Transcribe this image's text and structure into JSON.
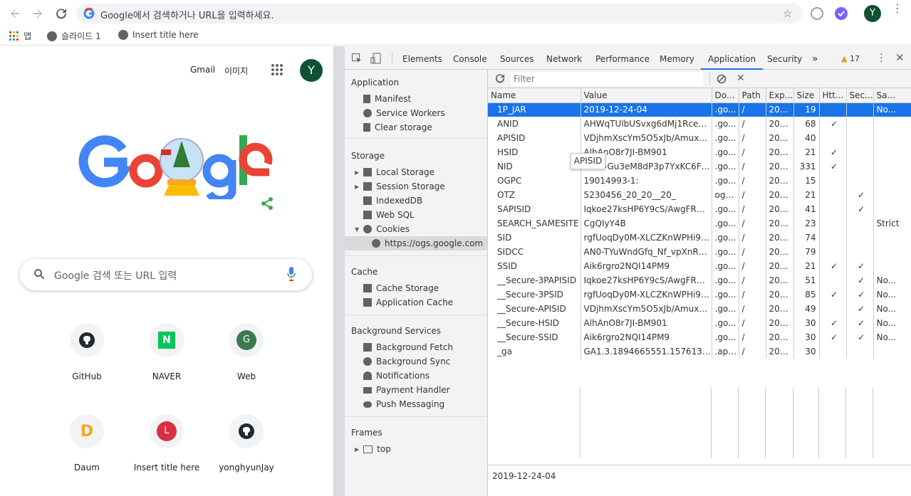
{
  "browser": {
    "omnibox_placeholder": "Google에서 검색하거나 URL을 입력하세요.",
    "avatar_letter": "Y",
    "bookmarks": [
      {
        "label": "앱"
      },
      {
        "label": "슬라이드 1"
      },
      {
        "label": "Insert title here"
      }
    ]
  },
  "ntp": {
    "top_links": [
      "Gmail",
      "이미지"
    ],
    "avatar_letter": "Y",
    "search_placeholder": "Google 검색 또는 URL 입력",
    "shortcuts": [
      {
        "label": "GitHub",
        "glyph": "",
        "color": "#24292e"
      },
      {
        "label": "NAVER",
        "glyph": "N",
        "color": "#03c75a"
      },
      {
        "label": "Web",
        "glyph": "G",
        "color": "#3c7a4f"
      },
      {
        "label": "Daum",
        "glyph": "D",
        "color": "#f1f3f4"
      },
      {
        "label": "Insert title here",
        "glyph": "L",
        "color": "#d93040"
      },
      {
        "label": "yonghyunJay",
        "glyph": "",
        "color": "#24292e"
      }
    ]
  },
  "devtools": {
    "tabs": [
      "Elements",
      "Console",
      "Sources",
      "Network",
      "Performance",
      "Memory",
      "Application",
      "Security"
    ],
    "active_tab": "Application",
    "more_tabs": "»",
    "warnings": "17",
    "sidebar": {
      "application": {
        "title": "Application",
        "items": [
          "Manifest",
          "Service Workers",
          "Clear storage"
        ]
      },
      "storage": {
        "title": "Storage",
        "items": [
          "Local Storage",
          "Session Storage",
          "IndexedDB",
          "Web SQL",
          "Cookies",
          "https://ogs.google.com"
        ]
      },
      "cache": {
        "title": "Cache",
        "items": [
          "Cache Storage",
          "Application Cache"
        ]
      },
      "background": {
        "title": "Background Services",
        "items": [
          "Background Fetch",
          "Background Sync",
          "Notifications",
          "Payment Handler",
          "Push Messaging"
        ]
      },
      "frames": {
        "title": "Frames",
        "items": [
          "top"
        ]
      }
    },
    "filter_placeholder": "Filter",
    "columns": [
      "Name",
      "Value",
      "Do...",
      "Path",
      "Exp...",
      "Size",
      "Htt...",
      "Sec...",
      "Sa..."
    ],
    "cookies": [
      {
        "name": "1P_JAR",
        "value": "2019-12-24-04",
        "domain": ".go...",
        "path": "/",
        "expires": "202...",
        "size": "19",
        "http": "",
        "secure": "",
        "same": "No...",
        "selected": true
      },
      {
        "name": "ANID",
        "value": "AHWqTUlbUSvxg6dMj1RceKbA...",
        "domain": ".go...",
        "path": "/",
        "expires": "202...",
        "size": "68",
        "http": "✓",
        "secure": "",
        "same": ""
      },
      {
        "name": "APISID",
        "value": "VDjhmXscYm5O5xJb/Amux9Xa...",
        "domain": ".go...",
        "path": "/",
        "expires": "202...",
        "size": "40",
        "http": "",
        "secure": "",
        "same": ""
      },
      {
        "name": "HSID",
        "value": "AlhAnO8r7JI-BM901",
        "domain": ".go...",
        "path": "/",
        "expires": "202...",
        "size": "21",
        "http": "✓",
        "secure": "",
        "same": ""
      },
      {
        "name": "NID",
        "value": "194=Gu3eM8dP3p7YxKC6F-ldf...",
        "domain": ".go...",
        "path": "/",
        "expires": "202...",
        "size": "331",
        "http": "✓",
        "secure": "",
        "same": ""
      },
      {
        "name": "OGPC",
        "value": "19014993-1:",
        "domain": ".go...",
        "path": "/",
        "expires": "202...",
        "size": "15",
        "http": "",
        "secure": "",
        "same": ""
      },
      {
        "name": "OTZ",
        "value": "5230456_20_20__20_",
        "domain": "ogs....",
        "path": "/",
        "expires": "202...",
        "size": "21",
        "http": "",
        "secure": "✓",
        "same": ""
      },
      {
        "name": "SAPISID",
        "value": "Iqkoe27ksHP6Y9cS/AwgFRD6C...",
        "domain": ".go...",
        "path": "/",
        "expires": "202...",
        "size": "41",
        "http": "",
        "secure": "✓",
        "same": ""
      },
      {
        "name": "SEARCH_SAMESITE",
        "value": "CgQIyY4B",
        "domain": ".go...",
        "path": "/",
        "expires": "202...",
        "size": "23",
        "http": "",
        "secure": "",
        "same": "Strict"
      },
      {
        "name": "SID",
        "value": "rgfUoqDy0M-XLCZKnWPHi9Cji...",
        "domain": ".go...",
        "path": "/",
        "expires": "202...",
        "size": "74",
        "http": "",
        "secure": "",
        "same": ""
      },
      {
        "name": "SIDCC",
        "value": "AN0-TYuWndGfq_Nf_vpXnRc2...",
        "domain": ".go...",
        "path": "/",
        "expires": "202...",
        "size": "79",
        "http": "",
        "secure": "",
        "same": ""
      },
      {
        "name": "SSID",
        "value": "Aik6rgro2NQI14PM9",
        "domain": ".go...",
        "path": "/",
        "expires": "202...",
        "size": "21",
        "http": "✓",
        "secure": "✓",
        "same": ""
      },
      {
        "name": "__Secure-3PAPISID",
        "value": "Iqkoe27ksHP6Y9cS/AwgFRD6C...",
        "domain": ".go...",
        "path": "/",
        "expires": "202...",
        "size": "51",
        "http": "",
        "secure": "✓",
        "same": "No..."
      },
      {
        "name": "__Secure-3PSID",
        "value": "rgfUoqDy0M-XLCZKnWPHi9Cji...",
        "domain": ".go...",
        "path": "/",
        "expires": "202...",
        "size": "85",
        "http": "✓",
        "secure": "✓",
        "same": "No..."
      },
      {
        "name": "__Secure-APISID",
        "value": "VDjhmXscYm5O5xJb/Amux9Xa...",
        "domain": ".go...",
        "path": "/",
        "expires": "202...",
        "size": "49",
        "http": "",
        "secure": "✓",
        "same": "No..."
      },
      {
        "name": "__Secure-HSID",
        "value": "AlhAnO8r7JI-BM901",
        "domain": ".go...",
        "path": "/",
        "expires": "202...",
        "size": "30",
        "http": "✓",
        "secure": "✓",
        "same": "No..."
      },
      {
        "name": "__Secure-SSID",
        "value": "Aik6rgro2NQI14PM9",
        "domain": ".go...",
        "path": "/",
        "expires": "202...",
        "size": "30",
        "http": "✓",
        "secure": "✓",
        "same": "No..."
      },
      {
        "name": "_ga",
        "value": "GA1.3.1894665551.1576132024",
        "domain": ".api...",
        "path": "/",
        "expires": "202...",
        "size": "30",
        "http": "",
        "secure": "",
        "same": ""
      }
    ],
    "preview_value": "2019-12-24-04",
    "tooltip": "APISID"
  },
  "colors": {
    "accent": "#1a73e8",
    "avatar_bg": "#0f5132"
  }
}
